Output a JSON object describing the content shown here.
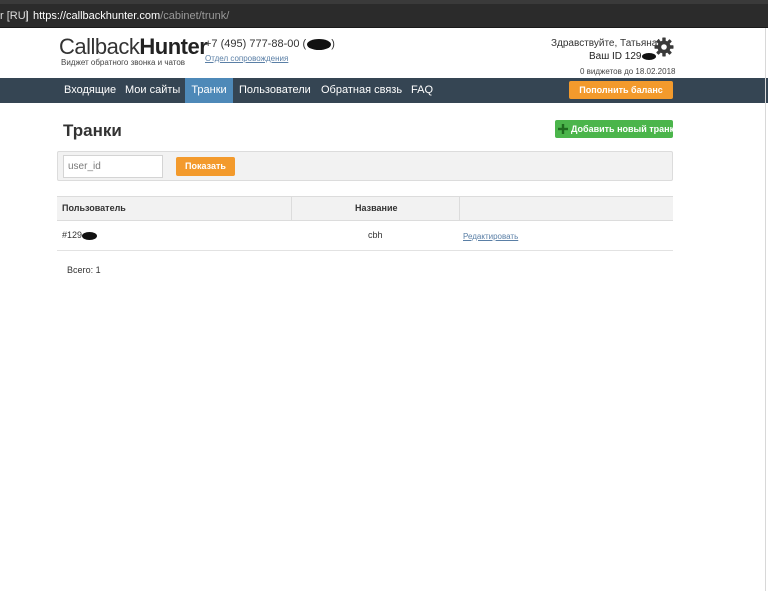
{
  "browser": {
    "lang_label": "r [RU]",
    "separator": "|",
    "url_host": "https://callbackhunter.com",
    "url_path": "/cabinet/trunk/"
  },
  "header": {
    "logo_light": "Callback",
    "logo_bold": "Hunter",
    "logo_subtitle": "Виджет обратного звонка и чатов",
    "phone": "+7 (495) 777-88-00 (",
    "phone_close": ")",
    "support_link": "Отдел сопровождения",
    "greeting": "Здравствуйте, Татьяна!",
    "user_id_label": "Ваш ID 129",
    "widgets_info": "0 виджетов до 18.02.2018"
  },
  "nav": {
    "items": [
      {
        "label": "Входящие",
        "active": false
      },
      {
        "label": "Мои сайты",
        "active": false
      },
      {
        "label": "Транки",
        "active": true
      },
      {
        "label": "Пользователи",
        "active": false
      },
      {
        "label": "Обратная связь",
        "active": false
      },
      {
        "label": "FAQ",
        "active": false
      }
    ],
    "topup_button": "Пополнить баланс"
  },
  "page": {
    "title": "Транки",
    "add_button": "Добавить новый транк"
  },
  "filter": {
    "placeholder": "user_id",
    "value": "",
    "show_button": "Показать"
  },
  "table": {
    "columns": [
      "Пользователь",
      "Название",
      ""
    ],
    "rows": [
      {
        "user": "#129",
        "name": "cbh",
        "action": "Редактировать"
      }
    ]
  },
  "summary": {
    "total": "Всего: 1"
  },
  "colors": {
    "navbar": "#354553",
    "nav_active": "#4e89b8",
    "orange_button": "#f39a2c",
    "green_button": "#4bb54b",
    "link": "#5a7fa6"
  }
}
